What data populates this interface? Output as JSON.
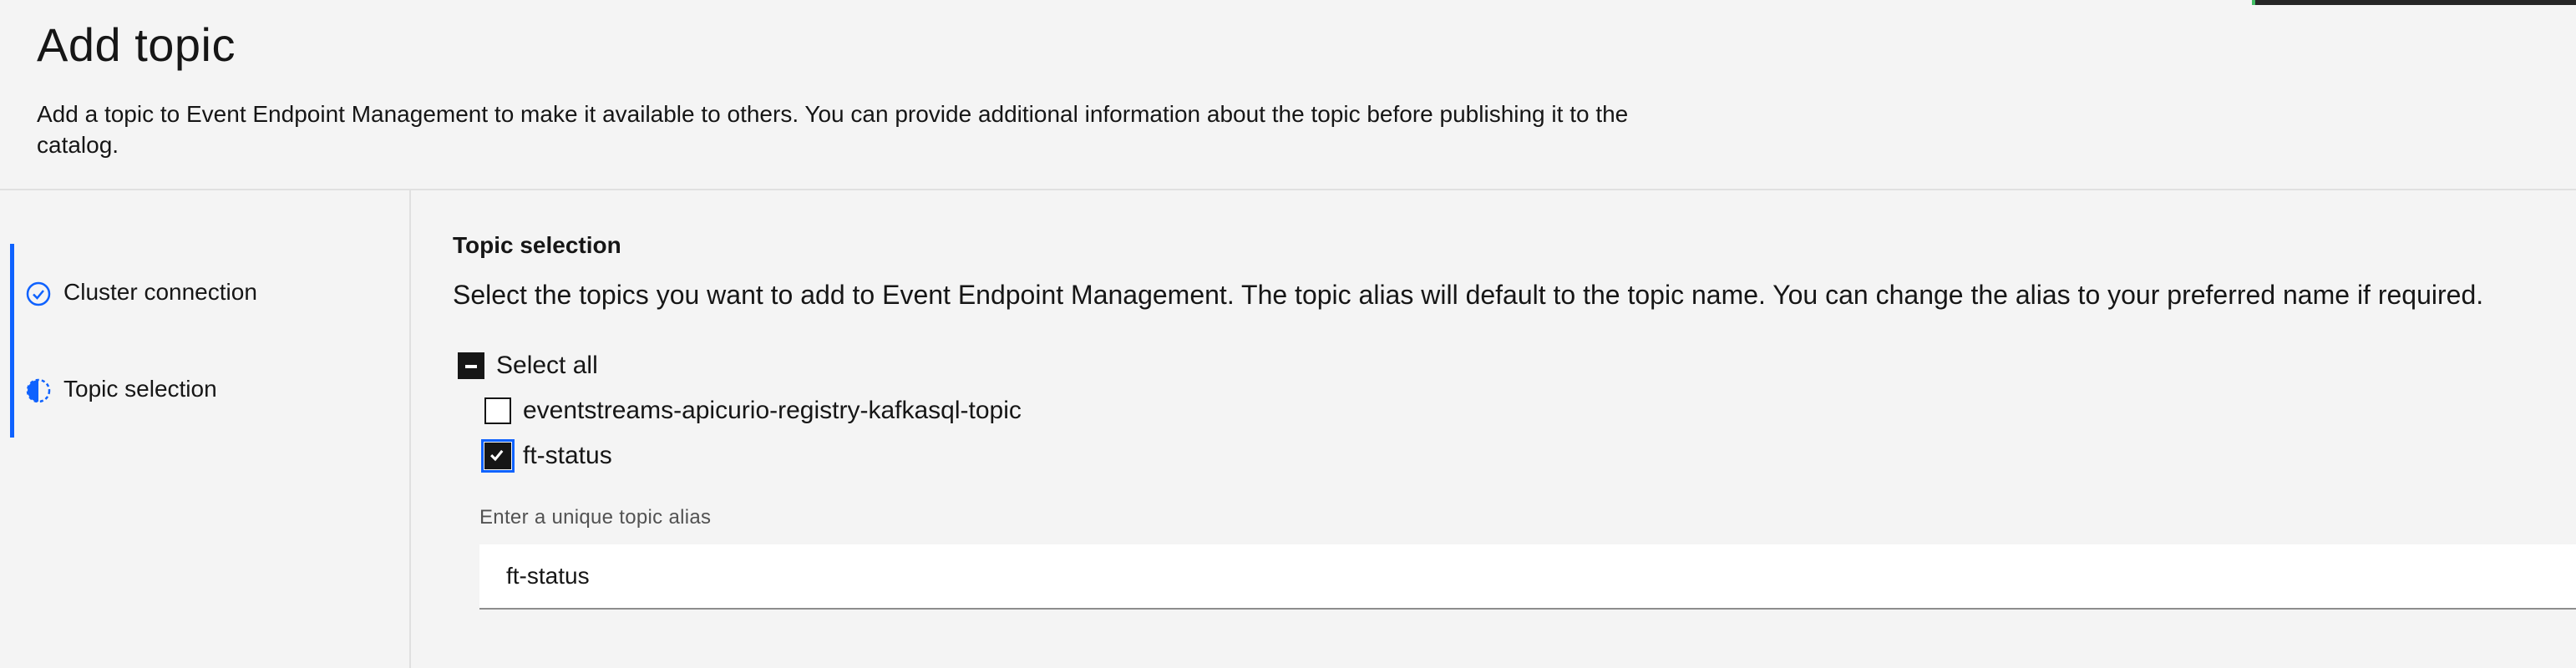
{
  "page": {
    "title": "Add topic",
    "description": "Add a topic to Event Endpoint Management to make it available to others. You can provide additional information about the topic before publishing it to the catalog."
  },
  "steps": [
    {
      "label": "Cluster connection",
      "status": "complete",
      "icon": "checkmark-outline-icon"
    },
    {
      "label": "Topic selection",
      "status": "current",
      "icon": "incomplete-icon"
    }
  ],
  "topic_selection": {
    "title": "Topic selection",
    "description": "Select the topics you want to add to Event Endpoint Management. The topic alias will default to the topic name. You can change the alias to your preferred name if required.",
    "select_all": {
      "label": "Select all",
      "state": "indeterminate"
    },
    "topics": [
      {
        "name": "eventstreams-apicurio-registry-kafkasql-topic",
        "checked": false
      },
      {
        "name": "ft-status",
        "checked": true
      }
    ],
    "alias": {
      "label": "Enter a unique topic alias",
      "value": "ft-status"
    }
  },
  "colors": {
    "accent": "#0f62fe",
    "background": "#f4f4f4",
    "text": "#161616"
  }
}
